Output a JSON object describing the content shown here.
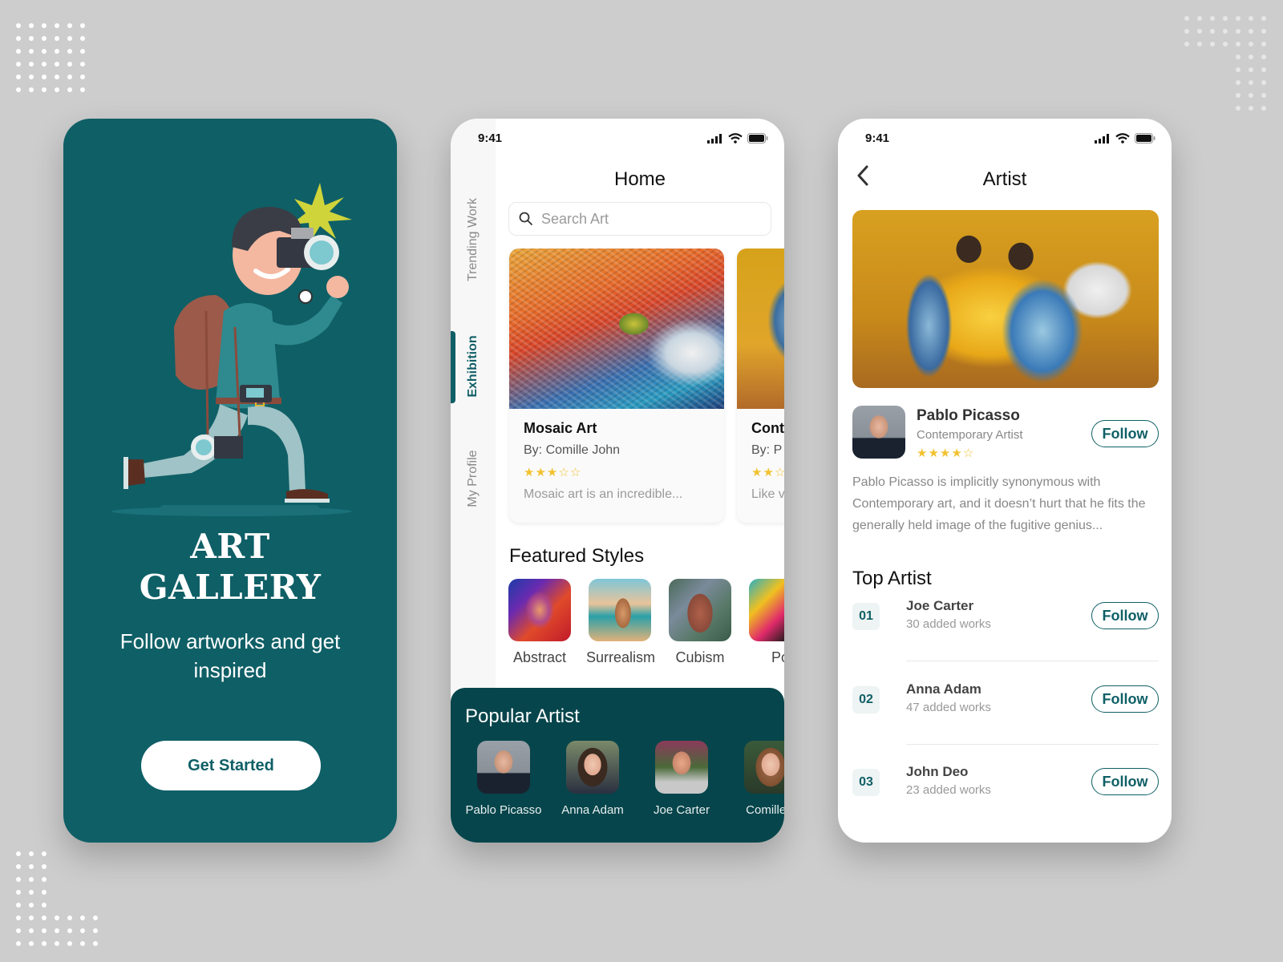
{
  "colors": {
    "background": "#cdcdcd",
    "primary": "#0f5f66",
    "popular_bg": "#06454b",
    "star": "#f2c230"
  },
  "onboarding": {
    "title_line1": "ART",
    "title_line2": "GALLERY",
    "subtitle": "Follow artworks and get inspired",
    "cta_label": "Get Started",
    "illustration": "photographer-illustration"
  },
  "home": {
    "status": {
      "time": "9:41",
      "icons": [
        "signal-icon",
        "wifi-icon",
        "battery-icon"
      ]
    },
    "title": "Home",
    "search": {
      "placeholder": "Search Art",
      "value": ""
    },
    "side_tabs": [
      {
        "label": "Trending Work",
        "active": false
      },
      {
        "label": "Exhibition",
        "active": true
      },
      {
        "label": "My Profile",
        "active": false
      }
    ],
    "artworks": [
      {
        "name": "Mosaic Art",
        "by": "By: Comille John",
        "rating": 3,
        "max_rating": 5,
        "desc": "Mosaic art is an incredible..."
      },
      {
        "name": "Cont",
        "by": "By: P",
        "rating": 2,
        "max_rating": 5,
        "desc": "Like v"
      }
    ],
    "featured_title": "Featured Styles",
    "styles": [
      {
        "label": "Abstract"
      },
      {
        "label": "Surrealism"
      },
      {
        "label": "Cubism"
      },
      {
        "label": "Po"
      }
    ],
    "popular_title": "Popular Artist",
    "popular_artists": [
      {
        "name": "Pablo Picasso"
      },
      {
        "name": "Anna Adam"
      },
      {
        "name": "Joe Carter"
      },
      {
        "name": "Comille J"
      }
    ]
  },
  "artist": {
    "status": {
      "time": "9:41"
    },
    "title": "Artist",
    "back_label": "back",
    "name": "Pablo Picasso",
    "role": "Contemporary Artist",
    "rating": 4,
    "max_rating": 5,
    "follow_label": "Follow",
    "bio": "Pablo Picasso is implicitly synonymous with Contemporary art, and it doesn’t hurt that he fits the generally held image of the fugitive genius...",
    "top_title": "Top Artist",
    "top_artists": [
      {
        "rank": "01",
        "name": "Joe Carter",
        "works": "30 added works",
        "follow_label": "Follow"
      },
      {
        "rank": "02",
        "name": "Anna Adam",
        "works": "47 added works",
        "follow_label": "Follow"
      },
      {
        "rank": "03",
        "name": "John Deo",
        "works": "23 added works",
        "follow_label": "Follow"
      }
    ]
  }
}
